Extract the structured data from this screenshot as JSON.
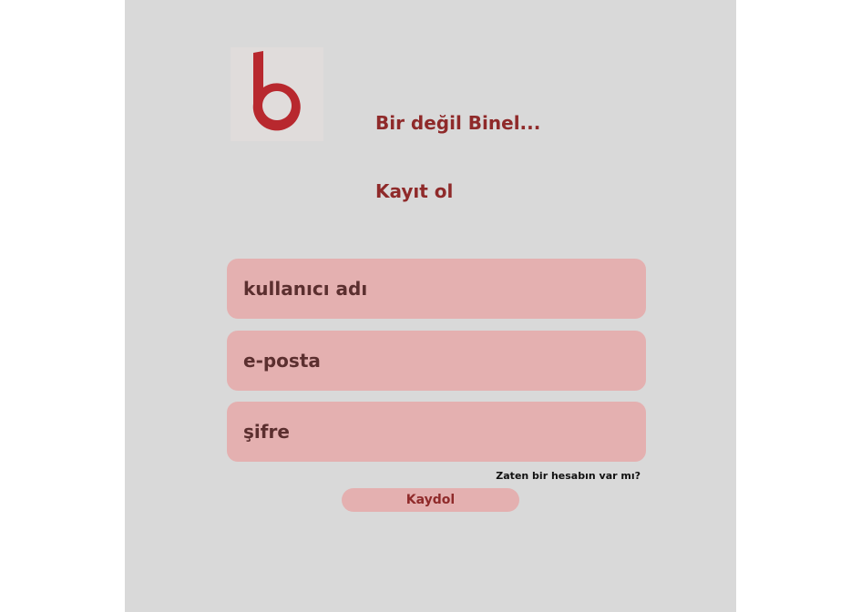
{
  "brand": {
    "logo_icon": "letter-b-logo-icon",
    "logo_color": "#b8282e",
    "tagline": "Bir değil Binel..."
  },
  "page": {
    "title": "Kayıt ol"
  },
  "form": {
    "username_placeholder": "kullanıcı adı",
    "email_placeholder": "e-posta",
    "password_placeholder": "şifre",
    "login_link": "Zaten bir hesabın var mı?",
    "submit_label": "Kaydol"
  },
  "colors": {
    "background": "#d9d9d9",
    "accent": "#8f2a2a",
    "field_fill": "#e4b0b0"
  }
}
